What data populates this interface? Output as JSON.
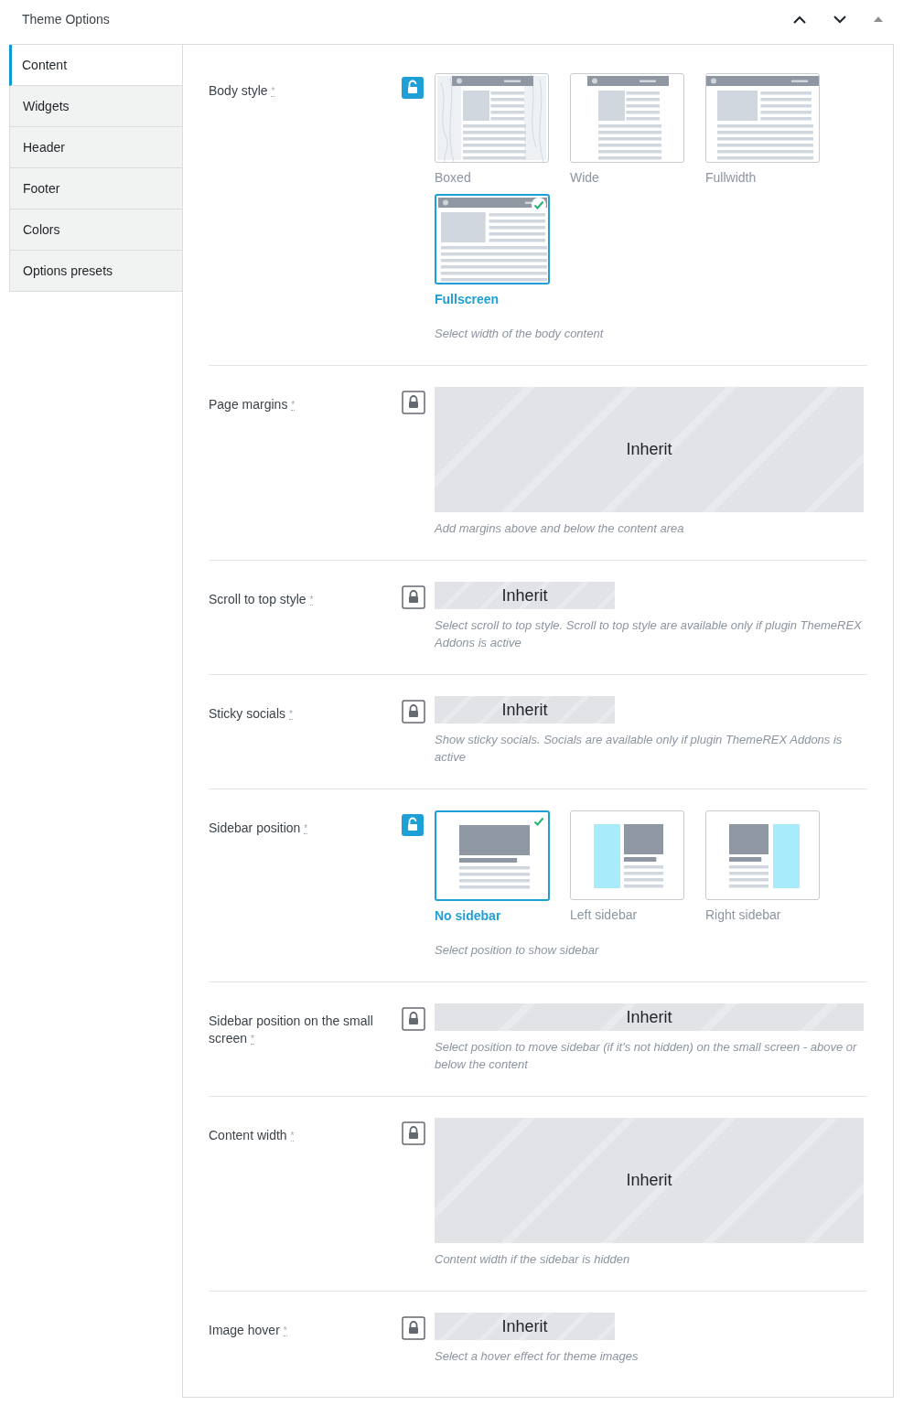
{
  "panel": {
    "title": "Theme Options"
  },
  "tabs": [
    {
      "label": "Content",
      "selected": true
    },
    {
      "label": "Widgets",
      "selected": false
    },
    {
      "label": "Header",
      "selected": false
    },
    {
      "label": "Footer",
      "selected": false
    },
    {
      "label": "Colors",
      "selected": false
    },
    {
      "label": "Options presets",
      "selected": false
    }
  ],
  "fields": [
    {
      "label": "Body style",
      "mark": "*",
      "locked": false,
      "kind": "images",
      "options": [
        {
          "label": "Boxed",
          "kind": "boxed",
          "selected": false
        },
        {
          "label": "Wide",
          "kind": "wide",
          "selected": false
        },
        {
          "label": "Fullwidth",
          "kind": "fullwidth",
          "selected": false
        },
        {
          "label": "Fullscreen",
          "kind": "fullscreen",
          "selected": true
        }
      ],
      "description": "Select width of the body content"
    },
    {
      "label": "Page margins",
      "mark": "*",
      "locked": true,
      "kind": "large",
      "value": "Inherit",
      "description": "Add margins above and below the content area"
    },
    {
      "label": "Scroll to top style",
      "mark": "*",
      "locked": true,
      "kind": "short",
      "value": "Inherit",
      "description": "Select scroll to top style. Scroll to top style are available only if plugin ThemeREX Addons is active"
    },
    {
      "label": "Sticky socials",
      "mark": "*",
      "locked": true,
      "kind": "short",
      "value": "Inherit",
      "description": "Show sticky socials. Socials are available only if plugin ThemeREX Addons is active"
    },
    {
      "label": "Sidebar position",
      "mark": "*",
      "locked": false,
      "kind": "images",
      "options": [
        {
          "label": "No sidebar",
          "kind": "nosidebar",
          "selected": true
        },
        {
          "label": "Left sidebar",
          "kind": "leftsidebar",
          "selected": false
        },
        {
          "label": "Right sidebar",
          "kind": "rightsidebar",
          "selected": false
        }
      ],
      "description": "Select position to show sidebar"
    },
    {
      "label": "Sidebar position on the small screen",
      "mark": "*",
      "locked": true,
      "kind": "wide",
      "value": "Inherit",
      "description": "Select position to move sidebar (if it's not hidden) on the small screen - above or below the content"
    },
    {
      "label": "Content width",
      "mark": "*",
      "locked": true,
      "kind": "large",
      "value": "Inherit",
      "description": "Content width if the sidebar is hidden"
    },
    {
      "label": "Image hover",
      "mark": "*",
      "locked": true,
      "kind": "short",
      "value": "Inherit",
      "description": "Select a hover effect for theme images"
    }
  ]
}
